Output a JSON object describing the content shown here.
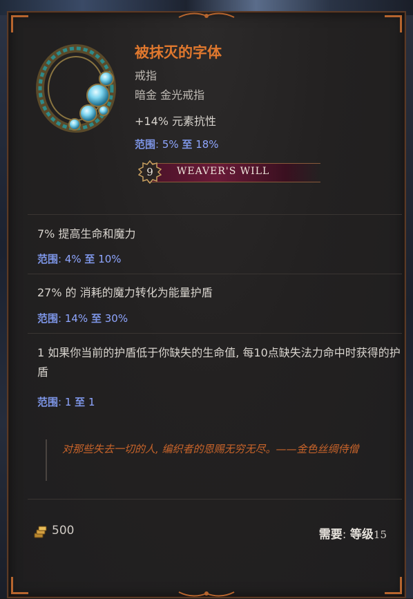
{
  "item": {
    "name": "被抹灭的字体",
    "subtype": "戒指",
    "rarity_line": "暗金 金光戒指",
    "implicit": "+14% 元素抗性",
    "implicit_range": {
      "label": "范围",
      "min": "5%",
      "to": "至",
      "max": "18%"
    }
  },
  "set": {
    "level": "9",
    "name": "WEAVER'S WILL"
  },
  "affixes": [
    {
      "text": "7% 提高生命和魔力",
      "range": {
        "label": "范围",
        "min": "4%",
        "to": "至",
        "max": "10%"
      }
    },
    {
      "text": "27% 的 消耗的魔力转化为能量护盾",
      "range": {
        "label": "范围",
        "min": "14%",
        "to": "至",
        "max": "30%"
      }
    },
    {
      "text": "1 如果你当前的护盾低于你缺失的生命值, 每10点缺失法力命中时获得的护盾",
      "range": {
        "label": "范围",
        "min": "1",
        "to": "至",
        "max": "1"
      }
    }
  ],
  "flavor_text": "对那些失去一切的人, 编织者的恩赐无穷无尽。——金色丝绸侍僧",
  "footer": {
    "gold_value": "500",
    "requirement_label": "需要",
    "level_label": "等级",
    "level_value": "15"
  },
  "colors": {
    "title": "#e0782e",
    "range_label": "#7d95e6",
    "flavor": "#c9642a",
    "frame": "#b7652e"
  },
  "icons": {
    "gold": "gold-coin-stack-icon",
    "item": "ring-item-icon"
  }
}
